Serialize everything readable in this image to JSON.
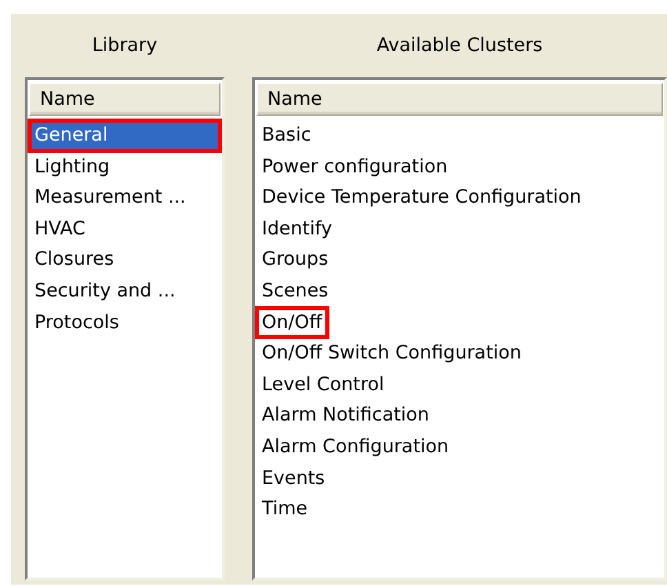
{
  "panels": [
    {
      "title": "Library",
      "column": "Name",
      "items": [
        {
          "label": "General",
          "selected": true,
          "highlighted": true
        },
        {
          "label": "Lighting",
          "selected": false,
          "highlighted": false
        },
        {
          "label": "Measurement ...",
          "selected": false,
          "highlighted": false
        },
        {
          "label": "HVAC",
          "selected": false,
          "highlighted": false
        },
        {
          "label": "Closures",
          "selected": false,
          "highlighted": false
        },
        {
          "label": "Security and ...",
          "selected": false,
          "highlighted": false
        },
        {
          "label": "Protocols",
          "selected": false,
          "highlighted": false
        }
      ]
    },
    {
      "title": "Available Clusters",
      "column": "Name",
      "items": [
        {
          "label": "Basic",
          "selected": false,
          "highlighted": false
        },
        {
          "label": "Power configuration",
          "selected": false,
          "highlighted": false
        },
        {
          "label": "Device Temperature Configuration",
          "selected": false,
          "highlighted": false
        },
        {
          "label": "Identify",
          "selected": false,
          "highlighted": false
        },
        {
          "label": "Groups",
          "selected": false,
          "highlighted": false
        },
        {
          "label": "Scenes",
          "selected": false,
          "highlighted": false
        },
        {
          "label": "On/Off",
          "selected": false,
          "highlighted": true
        },
        {
          "label": "On/Off Switch Configuration",
          "selected": false,
          "highlighted": false
        },
        {
          "label": "Level Control",
          "selected": false,
          "highlighted": false
        },
        {
          "label": "Alarm Notification",
          "selected": false,
          "highlighted": false
        },
        {
          "label": "Alarm Configuration",
          "selected": false,
          "highlighted": false
        },
        {
          "label": "Events",
          "selected": false,
          "highlighted": false
        },
        {
          "label": "Time",
          "selected": false,
          "highlighted": false
        }
      ]
    }
  ]
}
